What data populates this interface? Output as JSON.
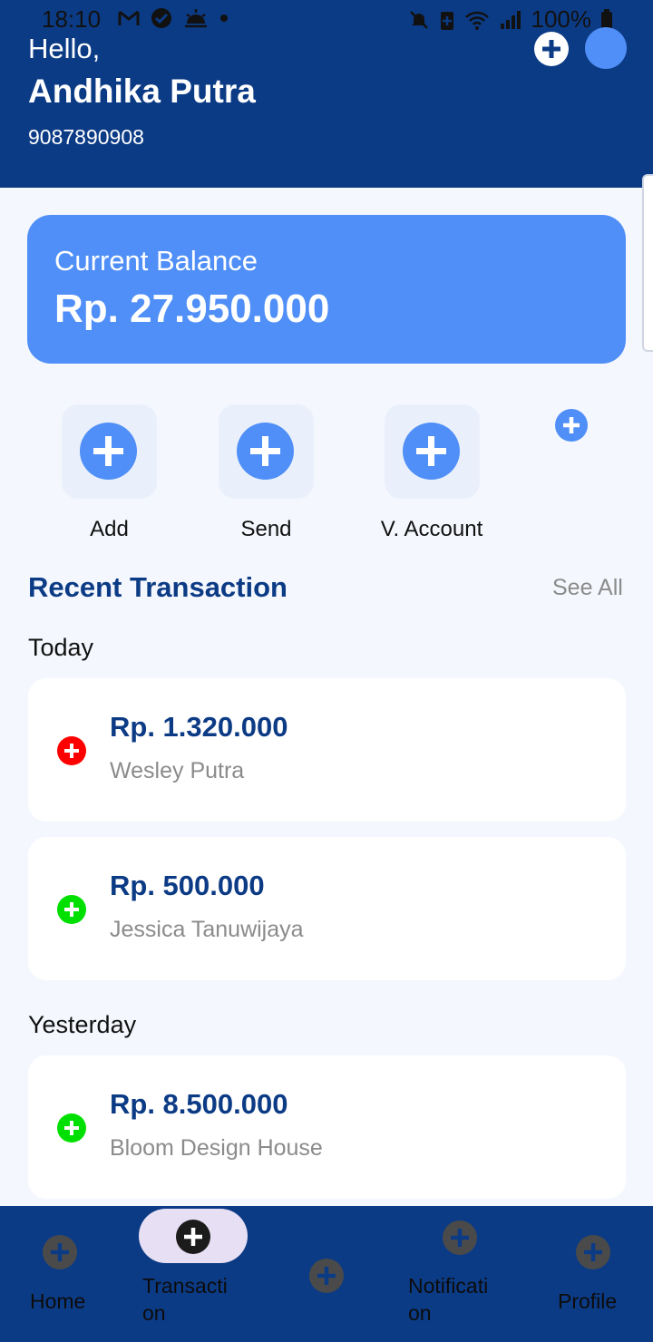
{
  "status_bar": {
    "time": "18:10",
    "battery": "100%",
    "icons": [
      "gmail-icon",
      "check-circle-icon",
      "weather-icon",
      "dot-icon",
      "mute-icon",
      "battery-saver-icon",
      "wifi-icon",
      "signal-icon",
      "battery-icon"
    ]
  },
  "header": {
    "greeting": "Hello,",
    "name": "Andhika Putra",
    "phone": "9087890908",
    "add_icon": "plus-circle-icon",
    "avatar_color": "#4f8ff7"
  },
  "balance": {
    "label": "Current Balance",
    "value": "Rp. 27.950.000"
  },
  "actions": [
    {
      "label": "Add",
      "icon": "plus-circle-icon"
    },
    {
      "label": "Send",
      "icon": "plus-circle-icon"
    },
    {
      "label": "V. Account",
      "icon": "plus-circle-icon"
    }
  ],
  "recent": {
    "title": "Recent Transaction",
    "see_all": "See All",
    "groups": [
      {
        "label": "Today",
        "items": [
          {
            "amount": "Rp. 1.320.000",
            "name": "Wesley Putra",
            "color": "#ff0000"
          },
          {
            "amount": "Rp. 500.000",
            "name": "Jessica Tanuwijaya",
            "color": "#00e000"
          }
        ]
      },
      {
        "label": "Yesterday",
        "items": [
          {
            "amount": "Rp. 8.500.000",
            "name": "Bloom Design House",
            "color": "#00e000"
          }
        ]
      }
    ]
  },
  "nav": {
    "home": "Home",
    "transaction_1": "Transacti",
    "transaction_2": "on",
    "notification_1": "Notificati",
    "notification_2": "on",
    "profile": "Profile"
  },
  "colors": {
    "primary": "#0c3b85",
    "accent": "#4f8ff7",
    "background": "#f4f7fd",
    "debit": "#ff0000",
    "credit": "#00e000"
  }
}
